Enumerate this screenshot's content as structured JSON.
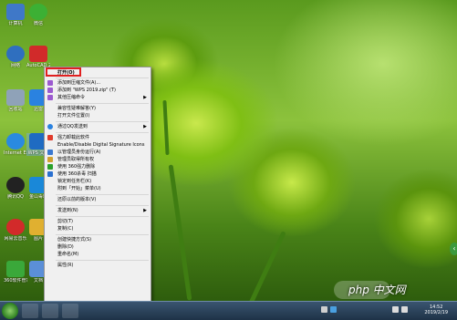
{
  "desktop": {
    "icons": [
      {
        "label": "计算机",
        "color": "#3f78c8"
      },
      {
        "label": "微信",
        "color": "#3cb034"
      },
      {
        "label": "网络",
        "color": "#2f6fbf"
      },
      {
        "label": "AutoCAD 2008 - 简体中文",
        "color": "#d12a2a"
      },
      {
        "label": "回收站",
        "color": "#8fa2b8"
      },
      {
        "label": "迅雷",
        "color": "#2a82e0"
      },
      {
        "label": "Internet Explorer",
        "color": "#2a8ae0"
      },
      {
        "label": "WPS 文字",
        "color": "#1f6bc2"
      },
      {
        "label": "腾讯QQ",
        "color": "#222222"
      },
      {
        "label": "金山毒霸",
        "color": "#1a88d8"
      },
      {
        "label": "网易云音乐",
        "color": "#d22a2a"
      },
      {
        "label": "图片",
        "color": "#e0b030"
      },
      {
        "label": "360软件管家",
        "color": "#3aa83a"
      },
      {
        "label": "文档",
        "color": "#5b8fd8"
      }
    ]
  },
  "context_menu": {
    "open": "打开(O)",
    "add_archive": "添加到压缩文件(A)...",
    "add_to_named": "添加到 \"WPS 2019.zip\" (T)",
    "other_commands": "其他压缩命令",
    "troubleshoot": "兼容性疑难解答(Y)",
    "open_location": "打开文件位置(I)",
    "send_qq": "通过QQ发送到",
    "rename_ext": "强力卸载此软件",
    "enable_signature": "Enable/Disable Digital Signature Icons",
    "scan_360": "以管理员身份运行(A)",
    "manage_360": "管理员取得所有权",
    "use_360_delete": "使用 360强力删除",
    "use_360_scan": "使用 360杀毒 扫描",
    "pin_taskbar": "锁定到任务栏(K)",
    "pin_start": "附到「开始」菜单(U)",
    "restore_prev": "还原以前的版本(V)",
    "send_to": "发送到(N)",
    "cut": "剪切(T)",
    "copy": "复制(C)",
    "create_shortcut": "创建快捷方式(S)",
    "delete": "删除(D)",
    "rename": "重命名(M)",
    "properties": "属性(R)"
  },
  "taskbar": {
    "time": "14:52",
    "date": "2019/2/19"
  },
  "watermark": "php 中文网",
  "colors": {
    "menu_bg": "#f0f0f0",
    "highlight": "#e02020",
    "taskbar": "#1e3247"
  }
}
